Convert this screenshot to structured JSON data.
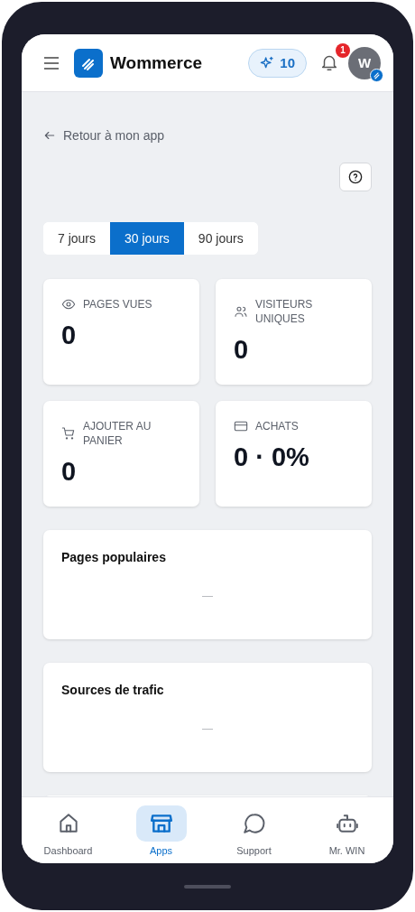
{
  "header": {
    "brand": "Wommerce",
    "credits": "10",
    "notifications": "1",
    "avatar": "W"
  },
  "back_link": "Retour à mon app",
  "period_tabs": [
    {
      "label": "7 jours",
      "selected": false
    },
    {
      "label": "30 jours",
      "selected": true
    },
    {
      "label": "90 jours",
      "selected": false
    }
  ],
  "stats": [
    {
      "kind": "views",
      "label": "PAGES VUES",
      "value": "0"
    },
    {
      "kind": "visitors",
      "label": "VISITEURS UNIQUES",
      "value": "0"
    },
    {
      "kind": "cart",
      "label": "AJOUTER AU PANIER",
      "value": "0"
    },
    {
      "kind": "purchases",
      "label": "ACHATS",
      "value": "0 · 0%"
    }
  ],
  "panels": [
    {
      "title": "Pages populaires",
      "empty": "—"
    },
    {
      "title": "Sources de trafic",
      "empty": "—"
    }
  ],
  "bottom_nav": [
    {
      "kind": "home",
      "label": "Dashboard",
      "selected": false
    },
    {
      "kind": "store",
      "label": "Apps",
      "selected": true
    },
    {
      "kind": "chat",
      "label": "Support",
      "selected": false
    },
    {
      "kind": "bot",
      "label": "Mr. WIN",
      "selected": false
    }
  ]
}
